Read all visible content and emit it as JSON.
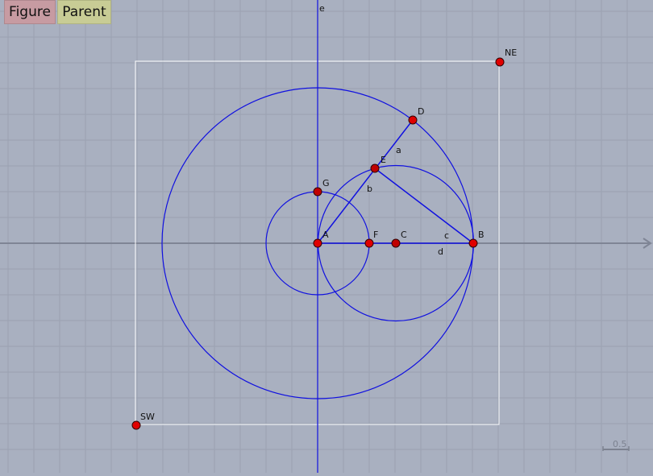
{
  "toolbar": {
    "figure_label": "Figure",
    "parent_label": "Parent",
    "figure_color": "#c79ba2",
    "parent_color": "#c8cc95"
  },
  "canvas": {
    "background": "#a9b0c0",
    "grid_color": "#9aa1b1",
    "axis_color": "#7f8595",
    "curve_color": "#1010e0",
    "point_color": "#e00000",
    "scale_label": "0.5",
    "axis_y_label": "e"
  },
  "points": [
    {
      "id": "A",
      "label": "A"
    },
    {
      "id": "B",
      "label": "B"
    },
    {
      "id": "C",
      "label": "C"
    },
    {
      "id": "D",
      "label": "D"
    },
    {
      "id": "E",
      "label": "E"
    },
    {
      "id": "F",
      "label": "F"
    },
    {
      "id": "G",
      "label": "G"
    },
    {
      "id": "NE",
      "label": "NE"
    },
    {
      "id": "SW",
      "label": "SW"
    }
  ],
  "segments": [
    {
      "id": "a",
      "label": "a"
    },
    {
      "id": "b",
      "label": "b"
    },
    {
      "id": "c",
      "label": "c"
    },
    {
      "id": "d",
      "label": "d"
    }
  ]
}
